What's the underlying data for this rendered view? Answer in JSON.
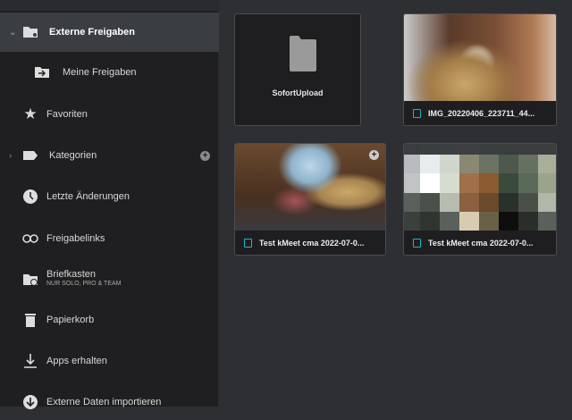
{
  "sidebar": {
    "items": [
      {
        "label": "Externe Freigaben",
        "icon": "folder-share-icon"
      },
      {
        "label": "Meine Freigaben",
        "icon": "folder-arrow-icon"
      },
      {
        "label": "Favoriten",
        "icon": "star-icon"
      },
      {
        "label": "Kategorien",
        "icon": "tag-icon"
      },
      {
        "label": "Letzte Änderungen",
        "icon": "clock-icon"
      },
      {
        "label": "Freigabelinks",
        "icon": "link-icon"
      },
      {
        "label": "Briefkasten",
        "sublabel": "NUR SOLO, PRO & TEAM",
        "icon": "folder-upload-icon"
      },
      {
        "label": "Papierkorb",
        "icon": "trash-icon"
      },
      {
        "label": "Apps erhalten",
        "icon": "download-icon"
      },
      {
        "label": "Externe Daten importieren",
        "icon": "import-icon"
      }
    ]
  },
  "files": [
    {
      "name": "SofortUpload",
      "type": "folder"
    },
    {
      "name": "IMG_20220406_223711_44...",
      "type": "image"
    },
    {
      "name": "Test kMeet cma 2022-07-0...",
      "type": "video"
    },
    {
      "name": "Test kMeet cma 2022-07-0...",
      "type": "video"
    }
  ],
  "colors": {
    "accent": "#1fb6c9"
  }
}
